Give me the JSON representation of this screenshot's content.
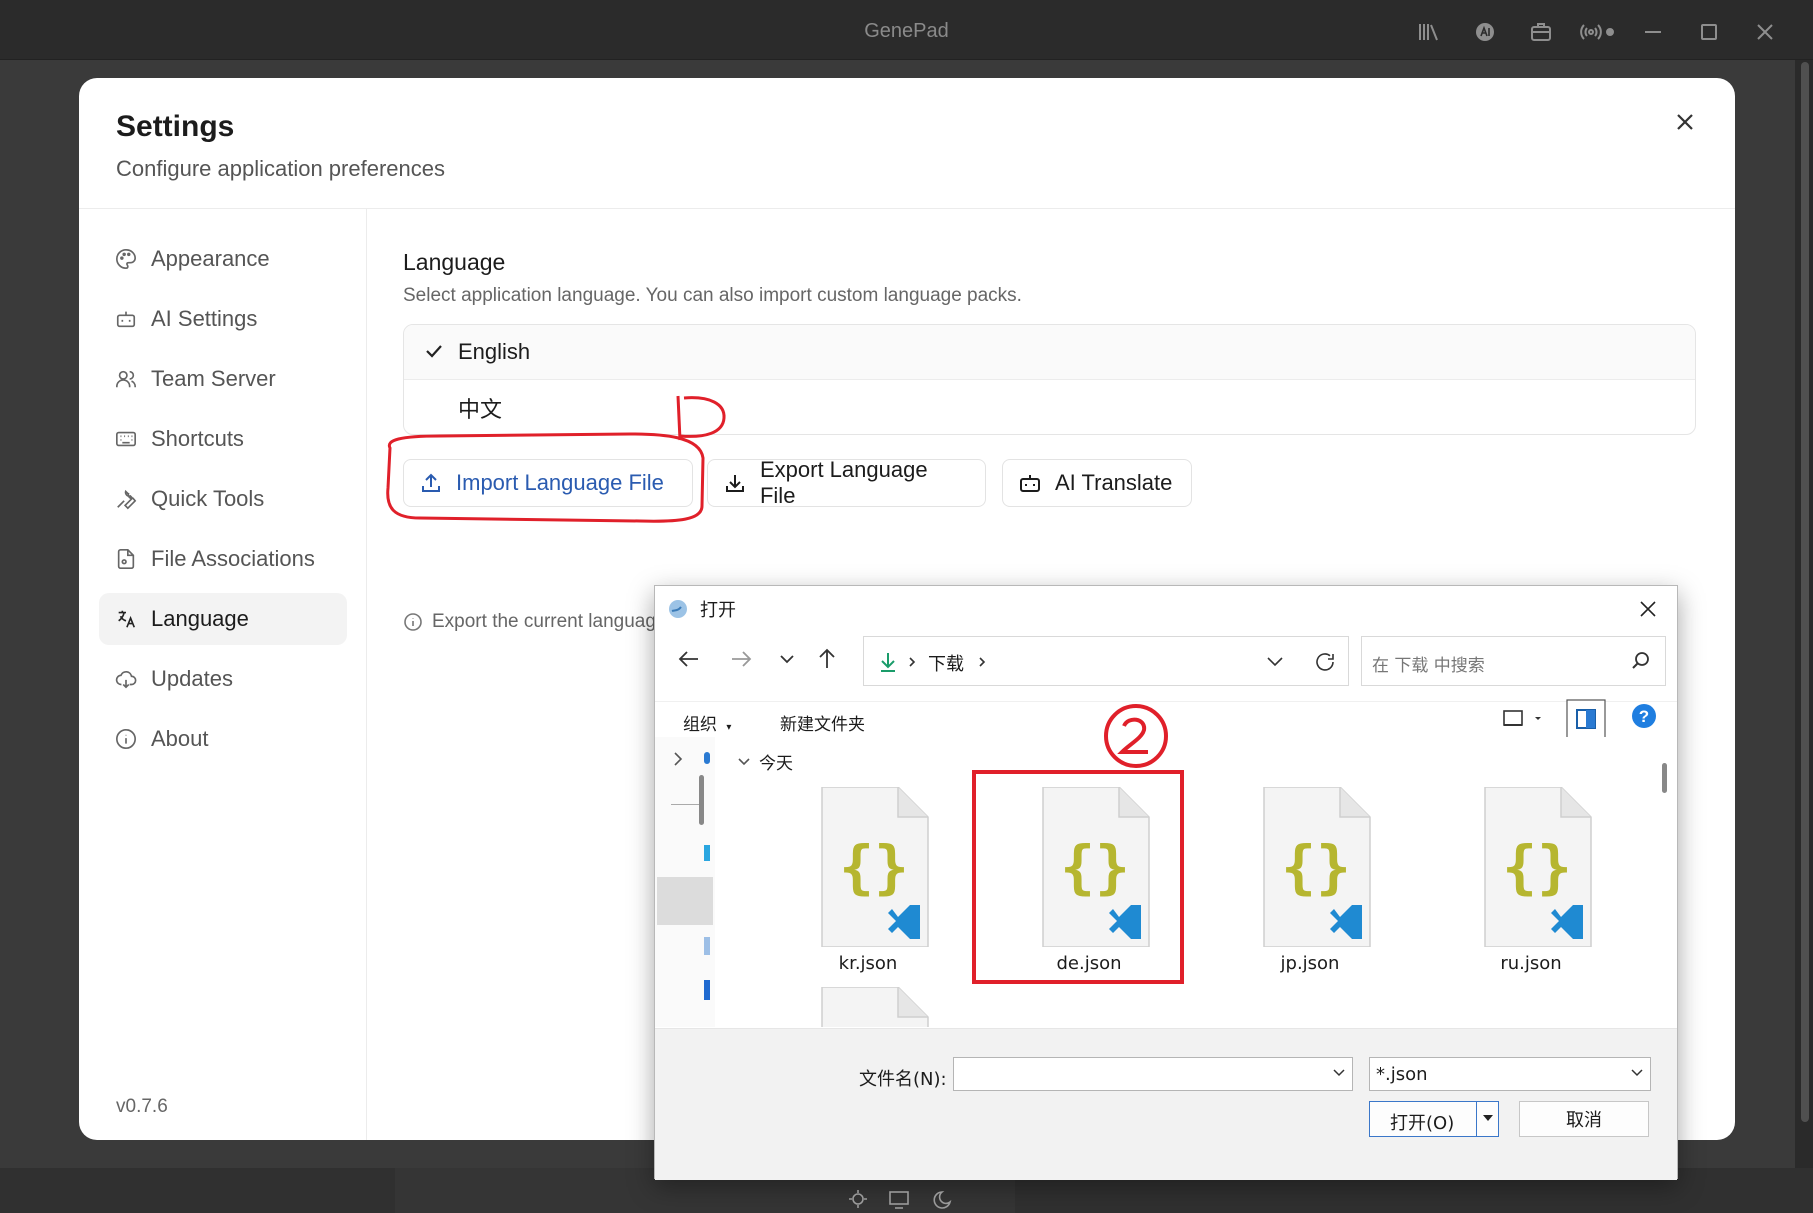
{
  "app": {
    "title": "GenePad"
  },
  "settings": {
    "title": "Settings",
    "subtitle": "Configure application preferences",
    "version": "v0.7.6",
    "nav": [
      {
        "label": "Appearance",
        "icon": "palette-icon"
      },
      {
        "label": "AI Settings",
        "icon": "bot-icon"
      },
      {
        "label": "Team Server",
        "icon": "users-icon"
      },
      {
        "label": "Shortcuts",
        "icon": "keyboard-icon"
      },
      {
        "label": "Quick Tools",
        "icon": "wrench-icon"
      },
      {
        "label": "File Associations",
        "icon": "file-link-icon"
      },
      {
        "label": "Language",
        "icon": "language-icon",
        "active": true
      },
      {
        "label": "Updates",
        "icon": "cloud-update-icon"
      },
      {
        "label": "About",
        "icon": "info-icon"
      }
    ],
    "language": {
      "title": "Language",
      "description": "Select application language. You can also import custom language packs.",
      "options": [
        {
          "label": "English",
          "selected": true
        },
        {
          "label": "中文",
          "selected": false
        }
      ],
      "import_label": "Import Language File",
      "export_label": "Export Language File",
      "translate_label": "AI Translate",
      "hint": "Export the current language file, then proofread and correct the translations yourself for more accurate language adaptation."
    }
  },
  "dialog": {
    "title": "打开",
    "breadcrumb": "下载",
    "search_placeholder": "在 下载 中搜索",
    "organize_label": "组织",
    "new_folder_label": "新建文件夹",
    "group_label": "今天",
    "files": [
      {
        "name": "kr.json"
      },
      {
        "name": "de.json"
      },
      {
        "name": "jp.json"
      },
      {
        "name": "ru.json"
      }
    ],
    "filename_label": "文件名(N):",
    "filename_value": "",
    "filetype_value": "*.json",
    "open_label": "打开(O)",
    "cancel_label": "取消"
  },
  "colors": {
    "accent_blue": "#2a5bb0",
    "annotation_red": "#e0202a",
    "json_brace": "#b6b630",
    "vscode_blue": "#1f8ad2"
  }
}
